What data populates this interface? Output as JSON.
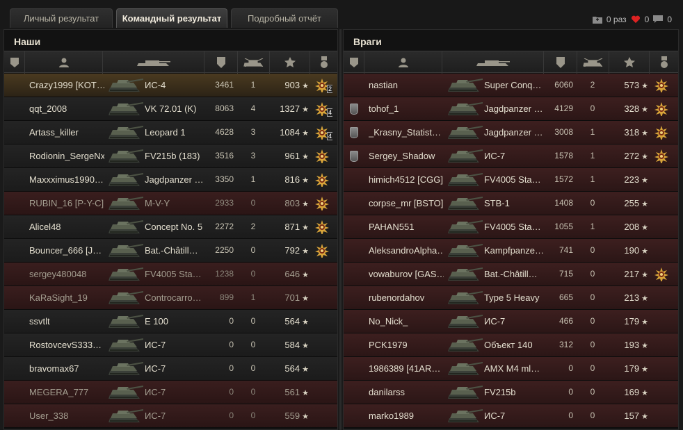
{
  "tabs": [
    "Личный результат",
    "Командный результат",
    "Подробный отчёт"
  ],
  "counters": {
    "battles_label": "0 раз",
    "likes": "0",
    "messages": "0"
  },
  "allies": {
    "title": "Наши",
    "rows": [
      {
        "name": "Crazy1999 [KOT…",
        "tank": "ИС-4",
        "damage": "3461",
        "frags": "1",
        "xp": "903",
        "medal": true,
        "medal_count": "2",
        "state": "selfrow"
      },
      {
        "name": "qqt_2008",
        "tank": "VK 72.01 (K)",
        "damage": "8063",
        "frags": "4",
        "xp": "1327",
        "medal": true,
        "medal_count": "4",
        "state": "ally"
      },
      {
        "name": "Artass_killer",
        "tank": "Leopard 1",
        "damage": "4628",
        "frags": "3",
        "xp": "1084",
        "medal": true,
        "medal_count": "4",
        "state": "ally"
      },
      {
        "name": "Rodionin_SergeNx",
        "tank": "FV215b (183)",
        "damage": "3516",
        "frags": "3",
        "xp": "961",
        "medal": true,
        "medal_count": "",
        "state": "ally"
      },
      {
        "name": "Maxxximus1990…",
        "tank": "Jagdpanzer …",
        "damage": "3350",
        "frags": "1",
        "xp": "816",
        "medal": true,
        "medal_count": "",
        "state": "ally"
      },
      {
        "name": "RUBIN_16 [P-Y-C]",
        "tank": "M-V-Y",
        "damage": "2933",
        "frags": "0",
        "xp": "803",
        "medal": true,
        "medal_count": "",
        "state": "dead"
      },
      {
        "name": "Alicel48",
        "tank": "Concept No. 5",
        "damage": "2272",
        "frags": "2",
        "xp": "871",
        "medal": true,
        "medal_count": "",
        "state": "ally"
      },
      {
        "name": "Bouncer_666 [J…",
        "tank": "Bat.-Châtill…",
        "damage": "2250",
        "frags": "0",
        "xp": "792",
        "medal": true,
        "medal_count": "",
        "state": "ally"
      },
      {
        "name": "sergey480048",
        "tank": "FV4005 Sta…",
        "damage": "1238",
        "frags": "0",
        "xp": "646",
        "medal": false,
        "medal_count": "",
        "state": "dead"
      },
      {
        "name": "KaRaSight_19",
        "tank": "Controcarro…",
        "damage": "899",
        "frags": "1",
        "xp": "701",
        "medal": false,
        "medal_count": "",
        "state": "dead"
      },
      {
        "name": "ssvtlt",
        "tank": "E 100",
        "damage": "0",
        "frags": "0",
        "xp": "564",
        "medal": false,
        "medal_count": "",
        "state": "ally"
      },
      {
        "name": "RostovcevS333…",
        "tank": "ИС-7",
        "damage": "0",
        "frags": "0",
        "xp": "584",
        "medal": false,
        "medal_count": "",
        "state": "ally"
      },
      {
        "name": "bravomax67",
        "tank": "ИС-7",
        "damage": "0",
        "frags": "0",
        "xp": "564",
        "medal": false,
        "medal_count": "",
        "state": "ally"
      },
      {
        "name": "MEGERA_777",
        "tank": "ИС-7",
        "damage": "0",
        "frags": "0",
        "xp": "561",
        "medal": false,
        "medal_count": "",
        "state": "dead"
      },
      {
        "name": "User_338",
        "tank": "ИС-7",
        "damage": "0",
        "frags": "0",
        "xp": "559",
        "medal": false,
        "medal_count": "",
        "state": "dead"
      }
    ]
  },
  "enemies": {
    "title": "Враги",
    "rows": [
      {
        "name": "nastian",
        "tank": "Super Conq…",
        "damage": "6060",
        "frags": "2",
        "xp": "573",
        "medal": true,
        "rank": false
      },
      {
        "name": "tohof_1",
        "tank": "Jagdpanzer …",
        "damage": "4129",
        "frags": "0",
        "xp": "328",
        "medal": true,
        "rank": true
      },
      {
        "name": "_Krasny_Statist…",
        "tank": "Jagdpanzer …",
        "damage": "3008",
        "frags": "1",
        "xp": "318",
        "medal": true,
        "rank": true
      },
      {
        "name": "Sergey_Shadow",
        "tank": "ИС-7",
        "damage": "1578",
        "frags": "1",
        "xp": "272",
        "medal": true,
        "rank": true
      },
      {
        "name": "himich4512 [CGG]",
        "tank": "FV4005 Sta…",
        "damage": "1572",
        "frags": "1",
        "xp": "223",
        "medal": false,
        "rank": false
      },
      {
        "name": "corpse_mr [BSTO]",
        "tank": "STB-1",
        "damage": "1408",
        "frags": "0",
        "xp": "255",
        "medal": false,
        "rank": false
      },
      {
        "name": "PAHAN551",
        "tank": "FV4005 Sta…",
        "damage": "1055",
        "frags": "1",
        "xp": "208",
        "medal": false,
        "rank": false
      },
      {
        "name": "AleksandroAlpha…",
        "tank": "Kampfpanze…",
        "damage": "741",
        "frags": "0",
        "xp": "190",
        "medal": false,
        "rank": false
      },
      {
        "name": "vowaburov [GAS…",
        "tank": "Bat.-Châtill…",
        "damage": "715",
        "frags": "0",
        "xp": "217",
        "medal": true,
        "rank": false
      },
      {
        "name": "rubenordahov",
        "tank": "Type 5 Heavy",
        "damage": "665",
        "frags": "0",
        "xp": "213",
        "medal": false,
        "rank": false
      },
      {
        "name": "No_Nick_",
        "tank": "ИС-7",
        "damage": "466",
        "frags": "0",
        "xp": "179",
        "medal": false,
        "rank": false
      },
      {
        "name": "PCK1979",
        "tank": "Объект 140",
        "damage": "312",
        "frags": "0",
        "xp": "193",
        "medal": false,
        "rank": false
      },
      {
        "name": "1986389 [41AR…",
        "tank": "AMX M4 ml…",
        "damage": "0",
        "frags": "0",
        "xp": "179",
        "medal": false,
        "rank": false
      },
      {
        "name": "danilarss",
        "tank": "FV215b",
        "damage": "0",
        "frags": "0",
        "xp": "169",
        "medal": false,
        "rank": false
      },
      {
        "name": "marko1989",
        "tank": "ИС-7",
        "damage": "0",
        "frags": "0",
        "xp": "157",
        "medal": false,
        "rank": false
      }
    ]
  },
  "header_icons": [
    "rank-icon",
    "player-icon",
    "tank-icon",
    "damage-shield-icon",
    "frags-icon",
    "xp-star-icon",
    "medal-icon"
  ],
  "colors": {
    "ally_row": "#1f1f1f",
    "dead_row": "#321a1a",
    "enemy_row": "#341b1b",
    "medal": "#d9a53a"
  }
}
